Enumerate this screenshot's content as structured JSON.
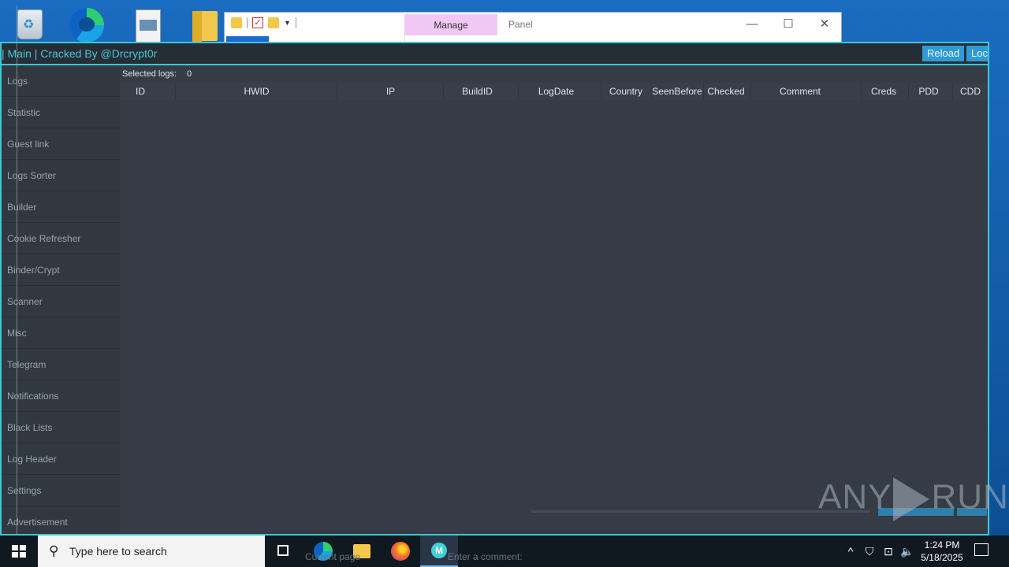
{
  "app": {
    "title": "| Main | Cracked By @Drcrypt0r",
    "buttons": {
      "reload": "Reload",
      "lock": "Lock"
    }
  },
  "explorer": {
    "ribbon_tab": "Manage",
    "window_title": "Panel",
    "controls": {
      "minimize": "—",
      "maximize": "☐",
      "close": "✕"
    }
  },
  "sidebar": {
    "items": [
      "Logs",
      "Statistic",
      "Guest link",
      "Logs Sorter",
      "Builder",
      "Cookie Refresher",
      "Binder/Crypt",
      "Scanner",
      "Misc",
      "Telegram",
      "Notifications",
      "Black Lists",
      "Log Header",
      "Settings",
      "Advertisement"
    ]
  },
  "logs": {
    "selected_label": "Selected logs:",
    "selected_count": "0",
    "columns": [
      "ID",
      "HWID",
      "IP",
      "BuildID",
      "LogDate",
      "Country",
      "SeenBefore",
      "Checked",
      "Comment",
      "Creds",
      "PDD",
      "CDD"
    ]
  },
  "footer_ghost": {
    "page": "Current page",
    "comment": "Enter a comment:"
  },
  "watermark": {
    "left": "ANY",
    "right": "RUN"
  },
  "taskbar": {
    "search_placeholder": "Type here to search",
    "time": "1:24 PM",
    "date": "5/18/2025",
    "app_letter": "M"
  }
}
